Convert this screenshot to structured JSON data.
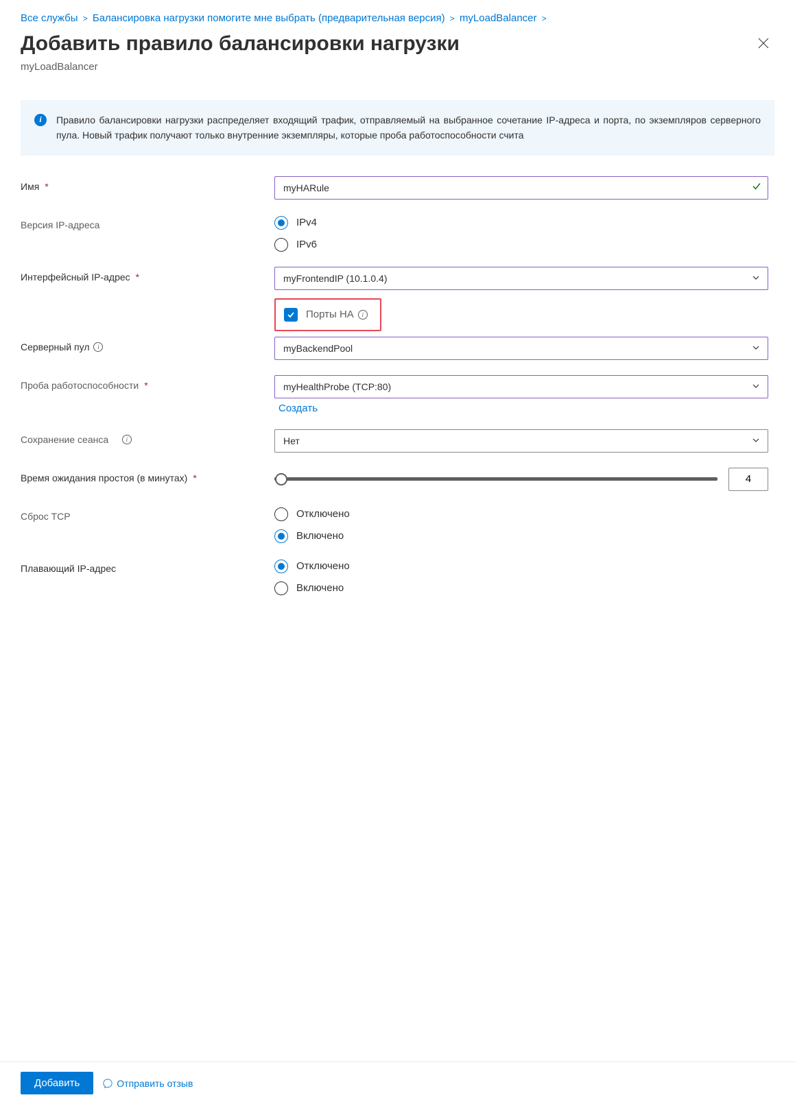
{
  "breadcrumbs": {
    "items": [
      "Все службы",
      "Балансировка нагрузки помогите мне выбрать (предварительная версия)",
      "myLoadBalancer"
    ]
  },
  "header": {
    "title": "Добавить правило балансировки нагрузки",
    "subtitle": "myLoadBalancer"
  },
  "banner": {
    "text": "Правило балансировки нагрузки распределяет входящий трафик, отправляемый на выбранное сочетание IP-адреса и порта, по экземпляров серверного пула. Новый трафик получают только внутренние экземпляры, которые проба работоспособности счита"
  },
  "form": {
    "name": {
      "label": "Имя",
      "value": "myHARule"
    },
    "ipVersion": {
      "label": "Версия IP-адреса",
      "options": {
        "ipv4": "IPv4",
        "ipv6": "IPv6"
      },
      "selected": "ipv4"
    },
    "frontendIp": {
      "label": "Интерфейсный IP-адрес",
      "value": "myFrontendIP (10.1.0.4)"
    },
    "haPorts": {
      "label": "Порты HA",
      "checked": true
    },
    "backendPool": {
      "label": "Серверный пул",
      "value": "myBackendPool"
    },
    "healthProbe": {
      "label": "Проба работоспособности",
      "value": "myHealthProbe (TCP:80)",
      "createLink": "Создать"
    },
    "sessionPersistence": {
      "label": "Сохранение сеанса",
      "value": "Нет"
    },
    "idleTimeout": {
      "label": "Время ожидания простоя (в минутах)",
      "value": "4"
    },
    "tcpReset": {
      "label": "Сброс TCP",
      "options": {
        "disabled": "Отключено",
        "enabled": "Включено"
      },
      "selected": "enabled"
    },
    "floatingIp": {
      "label": "Плавающий IP-адрес",
      "options": {
        "disabled": "Отключено",
        "enabled": "Включено"
      },
      "selected": "disabled"
    }
  },
  "footer": {
    "addButton": "Добавить",
    "feedbackLink": "Отправить отзыв"
  }
}
